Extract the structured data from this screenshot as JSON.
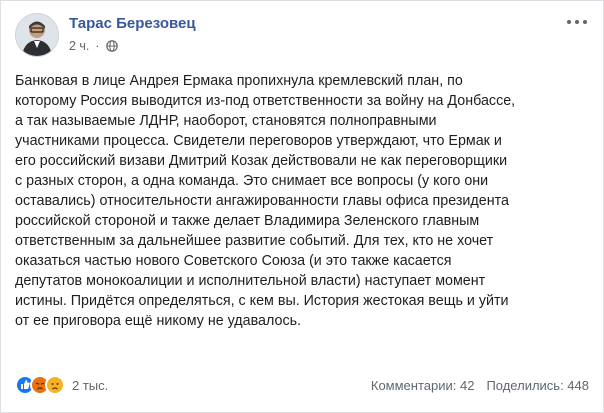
{
  "post": {
    "author": "Тарас Березовец",
    "time": "2 ч.",
    "lines": [
      "Банковая в лице Андрея Ермака пропихнула кремлевский план, по",
      "которому Россия выводится из-под ответственности за войну на Донбассе,",
      "а так называемые ЛДНР, наоборот, становятся полноправными",
      "участниками процесса. Свидетели переговоров утверждают, что Ермак и",
      "его российский визави Дмитрий Козак действовали не как переговорщики",
      "с разных сторон, а одна команда. Это снимает все вопросы (у кого они",
      "оставались) относительности ангажированности главы офиса президента",
      "российской стороной и также делает Владимира Зеленского главным",
      "ответственным за дальнейшее развитие событий. Для тех, кто не хочет",
      "оказаться частью нового Советского Союза (и это также касается",
      "депутатов монокоалиции и исполнительной власти) наступает момент",
      "истины. Придётся определяться, с кем вы. История жестокая вещь и уйти",
      "от ее приговора ещё никому не удавалось."
    ]
  },
  "footer": {
    "reaction_count": "2 тыс.",
    "comments": "Комментарии: 42",
    "shares": "Поделились: 448"
  },
  "icons": {
    "privacy": "globe-icon",
    "reactions": [
      "like-icon",
      "angry-icon",
      "sad-icon"
    ]
  },
  "colors": {
    "author": "#385898",
    "like": "#1877f2",
    "angry": "#e9710f",
    "sad": "#f7b125"
  }
}
